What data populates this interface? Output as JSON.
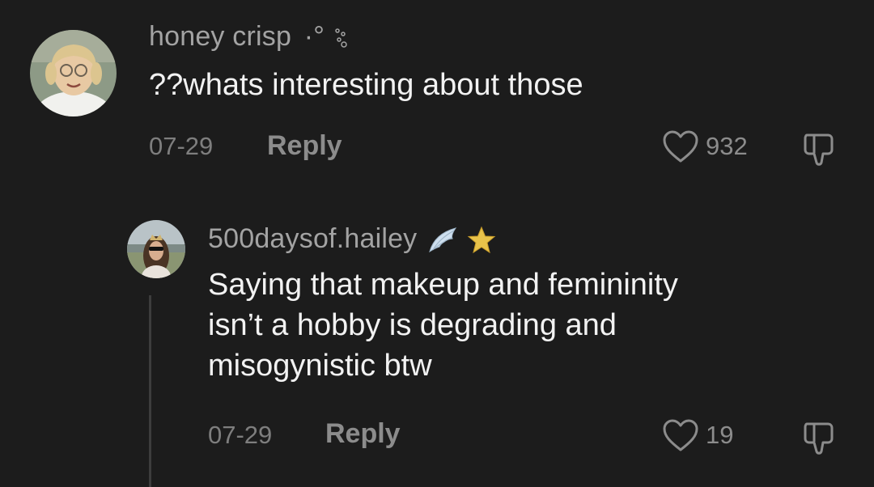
{
  "comment": {
    "username": "honey crisp",
    "username_decoration": "·°",
    "text": "??whats interesting about those",
    "date": "07-29",
    "reply_label": "Reply",
    "like_count": "932"
  },
  "reply_comment": {
    "username": "500daysof.hailey",
    "username_emojis": [
      "wing-emoji",
      "star-emoji"
    ],
    "text": "Saying that makeup and femininity\nisn’t a hobby is degrading and\nmisogynistic btw",
    "date": "07-29",
    "reply_label": "Reply",
    "like_count": "19"
  },
  "colors": {
    "background": "#1c1c1c",
    "username": "#a3a3a3",
    "text": "#f2f2f2",
    "meta": "#8c8c8c",
    "star": "#e8c24a"
  }
}
